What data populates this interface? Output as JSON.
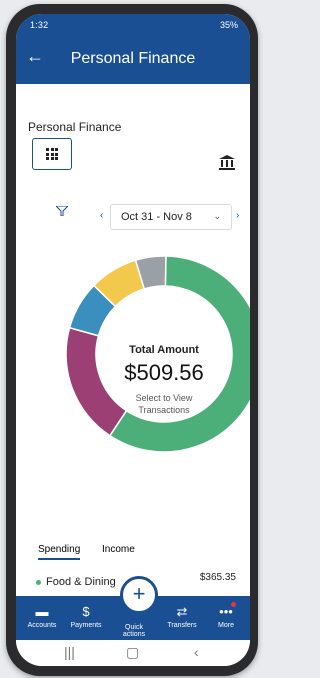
{
  "status_bar": {
    "time": "1:32",
    "right_text": "35%"
  },
  "header": {
    "title": "Personal Finance"
  },
  "section_label": "Personal Finance",
  "date_range": {
    "label": "Oct 31 - Nov 8"
  },
  "donut": {
    "center_label": "Total Amount",
    "total": "$509.56",
    "hint": "Select to View\nTransactions",
    "segments": [
      {
        "color": "#4caf7a",
        "fraction": 0.59
      },
      {
        "color": "#9c3f74",
        "fraction": 0.2
      },
      {
        "color": "#3b8fbf",
        "fraction": 0.08
      },
      {
        "color": "#f2c94c",
        "fraction": 0.08
      },
      {
        "color": "#9aa0a6",
        "fraction": 0.05
      }
    ]
  },
  "tabs": [
    {
      "label": "Spending",
      "active": true
    },
    {
      "label": "Income",
      "active": false
    }
  ],
  "category": {
    "name": "Food & Dining",
    "amount": "$365.35"
  },
  "bottom_nav": [
    {
      "label": "Accounts",
      "icon": "wallet-icon"
    },
    {
      "label": "Payments",
      "icon": "dollar-icon"
    },
    {
      "label": "Quick actions",
      "icon": "plus-icon"
    },
    {
      "label": "Transfers",
      "icon": "transfer-icon"
    },
    {
      "label": "More",
      "icon": "more-icon"
    }
  ],
  "colors": {
    "brand": "#1a4f93"
  }
}
